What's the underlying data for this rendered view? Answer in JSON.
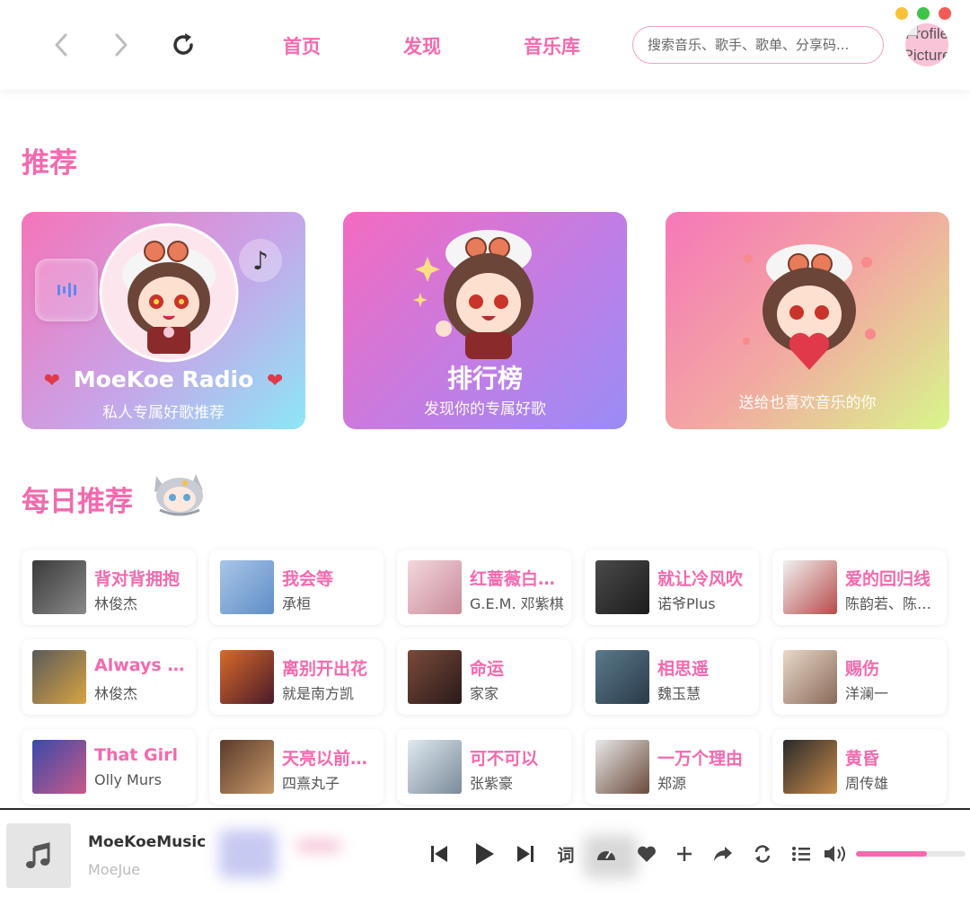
{
  "window": {
    "controls": [
      {
        "name": "minimize",
        "color": "#f7c23a"
      },
      {
        "name": "maximize",
        "color": "#3ec449"
      },
      {
        "name": "close",
        "color": "#f45b58"
      }
    ]
  },
  "header": {
    "back_icon": "chevron-left-icon",
    "forward_icon": "chevron-right-icon",
    "refresh_icon": "refresh-icon",
    "nav": [
      {
        "label": "首页"
      },
      {
        "label": "发现"
      },
      {
        "label": "音乐库"
      }
    ],
    "search_placeholder": "搜索音乐、歌手、歌单、分享码...",
    "avatar_alt_line1": "Profile",
    "avatar_alt_line2": "Picture"
  },
  "recommend": {
    "title": "推荐",
    "cards": [
      {
        "title": "MoeKoe Radio",
        "subtitle": "私人专属好歌推荐",
        "badge_icon": "sparkling-heart-icon",
        "note_icon": "music-note-icon",
        "play_icon": "equalizer-icon"
      },
      {
        "title": "排行榜",
        "subtitle": "发现你的专属好歌"
      },
      {
        "title": "",
        "subtitle": "送给也喜欢音乐的你"
      }
    ]
  },
  "daily": {
    "title": "每日推荐",
    "songs": [
      {
        "name": "背对背拥抱",
        "artist": "林俊杰",
        "cover": [
          "#3a3a3a",
          "#8a8a8a"
        ]
      },
      {
        "name": "我会等",
        "artist": "承桓",
        "cover": [
          "#a9c5e8",
          "#5f8ec7"
        ]
      },
      {
        "name": "红蔷薇白玫瑰",
        "artist": "G.E.M. 邓紫棋",
        "cover": [
          "#f3d7dc",
          "#c98a9a"
        ]
      },
      {
        "name": "就让冷风吹",
        "artist": "诺爷Plus",
        "cover": [
          "#4a4a4a",
          "#1c1c1c"
        ]
      },
      {
        "name": "爱的回归线",
        "artist": "陈韵若、陈乐一",
        "cover": [
          "#f1f1f1",
          "#b84a4a"
        ]
      },
      {
        "name": "Always Online",
        "artist": "林俊杰",
        "cover": [
          "#5a5a5a",
          "#d9a441"
        ]
      },
      {
        "name": "离别开出花",
        "artist": "就是南方凯",
        "cover": [
          "#d86a2a",
          "#4a1a2a"
        ]
      },
      {
        "name": "命运",
        "artist": "家家",
        "cover": [
          "#7a4a3a",
          "#2a1a1a"
        ]
      },
      {
        "name": "相思遥",
        "artist": "魏玉慧",
        "cover": [
          "#5a7a8a",
          "#2a3a4a"
        ]
      },
      {
        "name": "赐伤",
        "artist": "洋澜一",
        "cover": [
          "#e8d8c8",
          "#8a6a5a"
        ]
      },
      {
        "name": "That Girl",
        "artist": "Olly Murs",
        "cover": [
          "#3a4aa8",
          "#c85a8a"
        ]
      },
      {
        "name": "天亮以前说再见",
        "artist": "四熹丸子",
        "cover": [
          "#5a3a2a",
          "#c89a6a"
        ]
      },
      {
        "name": "可不可以",
        "artist": "张紫豪",
        "cover": [
          "#dfe9ef",
          "#7a8a9a"
        ]
      },
      {
        "name": "一万个理由",
        "artist": "郑源",
        "cover": [
          "#e8e8e8",
          "#6a4a3a"
        ]
      },
      {
        "name": "黄昏",
        "artist": "周传雄",
        "cover": [
          "#2a2a2a",
          "#c88a4a"
        ]
      }
    ]
  },
  "player": {
    "title": "MoeKoeMusic",
    "artist": "MoeJue",
    "cover_icon": "music-note-icon",
    "lyrics_label": "词",
    "volume": 0.65,
    "accent": "#f569ae"
  }
}
